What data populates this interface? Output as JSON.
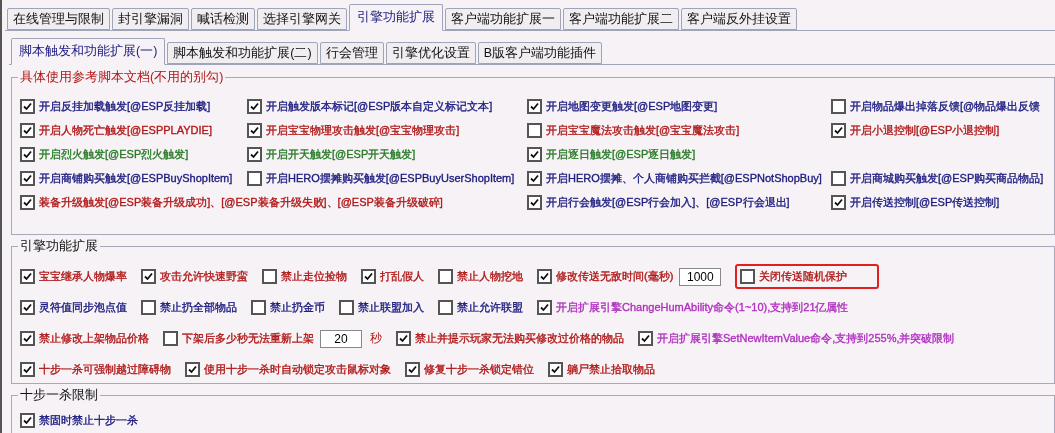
{
  "top_tabs": [
    {
      "label": "在线管理与限制",
      "selected": false
    },
    {
      "label": "封引擎漏洞",
      "selected": false
    },
    {
      "label": "喊话检测",
      "selected": false
    },
    {
      "label": "选择引擎网关",
      "selected": false
    },
    {
      "label": "引擎功能扩展",
      "selected": true
    },
    {
      "label": "客户端功能扩展一",
      "selected": false
    },
    {
      "label": "客户端功能扩展二",
      "selected": false
    },
    {
      "label": "客户端反外挂设置",
      "selected": false
    }
  ],
  "sub_tabs": [
    {
      "label": "脚本触发和功能扩展(一)",
      "selected": true
    },
    {
      "label": "脚本触发和功能扩展(二)",
      "selected": false
    },
    {
      "label": "行会管理",
      "selected": false
    },
    {
      "label": "引擎优化设置",
      "selected": false
    },
    {
      "label": "B版客户端功能插件",
      "selected": false
    }
  ],
  "script_group": {
    "title": "具体使用参考脚本文档(不用的别勾)",
    "rows": [
      [
        {
          "label": "开启反挂加载触发[@ESP反挂加载]",
          "checked": true,
          "color": "#1c1c80"
        },
        {
          "label": "开启触发版本标记[@ESP版本自定义标记文本]",
          "checked": true,
          "color": "#1c1c80"
        },
        {
          "label": "开启地图变更触发[@ESP地图变更]",
          "checked": true,
          "color": "#1c1c80"
        },
        {
          "label": "开启物品爆出掉落反馈[@物品爆出反馈",
          "checked": false,
          "color": "#1c1c80"
        }
      ],
      [
        {
          "label": "开启人物死亡触发[@ESPPLAYDIE]",
          "checked": true,
          "color": "#b01818"
        },
        {
          "label": "开启宝宝物理攻击触发[@宝宝物理攻击]",
          "checked": true,
          "color": "#b01818"
        },
        {
          "label": "开启宝宝魔法攻击触发[@宝宝魔法攻击]",
          "checked": false,
          "color": "#b01818"
        },
        {
          "label": "开启小退控制[@ESP小退控制]",
          "checked": true,
          "color": "#b01818"
        }
      ],
      [
        {
          "label": "开启烈火触发[@ESP烈火触发]",
          "checked": true,
          "color": "#267a26"
        },
        {
          "label": "开启开天触发[@ESP开天触发]",
          "checked": true,
          "color": "#267a26"
        },
        {
          "label": "开启逐日触发[@ESP逐日触发]",
          "checked": true,
          "color": "#267a26"
        }
      ],
      [
        {
          "label": "开启商铺购买触发[@ESPBuyShopItem]",
          "checked": true,
          "color": "#1c1c80"
        },
        {
          "label": "开启HERO摆摊购买触发[@ESPBuyUserShopItem]",
          "checked": false,
          "color": "#1c1c80"
        },
        {
          "label": "开启HERO摆摊、个人商铺购买拦截[@ESPNotShopBuy]",
          "checked": true,
          "color": "#1c1c80"
        },
        {
          "label": "开启商城购买触发[@ESP购买商品物品]",
          "checked": false,
          "color": "#1c1c80"
        }
      ],
      [
        {
          "label": "装备升级触发[@ESP装备升级成功]、[@ESP装备升级失败]、[@ESP装备升级破碎]",
          "checked": true,
          "color": "#b01818"
        },
        "",
        {
          "label": "开启行会触发[@ESP行会加入]、[@ESP行会退出]",
          "checked": true,
          "color": "#1c1c80"
        },
        {
          "label": "开启传送控制[@ESP传送控制]",
          "checked": true,
          "color": "#1c1c80"
        }
      ]
    ]
  },
  "engine_group": {
    "title": "引擎功能扩展",
    "lines": [
      {
        "items": [
          {
            "label": "宝宝继承人物爆率",
            "checked": true,
            "color": "#b01818"
          },
          {
            "label": "攻击允许快速野蛮",
            "checked": true,
            "color": "#b01818"
          },
          {
            "label": "禁止走位捡物",
            "checked": false,
            "color": "#b01818"
          },
          {
            "label": "打乱假人",
            "checked": true,
            "color": "#b01818"
          },
          {
            "label": "禁止人物挖地",
            "checked": false,
            "color": "#b01818"
          },
          {
            "label": "修改传送无敌时间(毫秒)",
            "checked": true,
            "color": "#b01818",
            "value": "1000"
          },
          {
            "label": "关闭传送随机保护",
            "checked": false,
            "color": "#b01818",
            "highlighted": true
          }
        ]
      },
      {
        "items": [
          {
            "label": "灵符值同步泡点值",
            "checked": true,
            "color": "#1c1c80"
          },
          {
            "label": "禁止扔全部物品",
            "checked": false,
            "color": "#1c1c80"
          },
          {
            "label": "禁止扔金币",
            "checked": false,
            "color": "#1c1c80"
          },
          {
            "label": "禁止联盟加入",
            "checked": false,
            "color": "#1c1c80"
          },
          {
            "label": "禁止允许联盟",
            "checked": false,
            "color": "#1c1c80"
          },
          {
            "label": "开启扩展引擎ChangeHumAbility命令(1~10),支持到21亿属性",
            "checked": true,
            "color": "#b030c0"
          }
        ]
      },
      {
        "items": [
          {
            "label": "禁止修改上架物品价格",
            "checked": true,
            "color": "#b01818"
          },
          {
            "label": "下架后多少秒无法重新上架",
            "checked": false,
            "color": "#b01818",
            "value": "20",
            "suffix": "秒"
          },
          {
            "label": "禁止并提示玩家无法购买修改过价格的物品",
            "checked": true,
            "color": "#b01818"
          },
          {
            "label": "开启扩展引擎SetNewItemValue命令,支持到255%,并突破限制",
            "checked": true,
            "color": "#b030c0"
          }
        ]
      },
      {
        "items": [
          {
            "label": "十步一杀可强制越过障碍物",
            "checked": true,
            "color": "#b01818"
          },
          {
            "label": "使用十步一杀时自动锁定攻击鼠标对象",
            "checked": true,
            "color": "#b01818"
          },
          {
            "label": "修复十步一杀锁定错位",
            "checked": true,
            "color": "#b01818"
          },
          {
            "label": "躺尸禁止拾取物品",
            "checked": true,
            "color": "#b01818"
          }
        ]
      }
    ]
  },
  "tenstep_group": {
    "title": "十步一杀限制",
    "lines": [
      {
        "items": [
          {
            "label": "禁固时禁止十步一杀",
            "checked": true,
            "color": "#1c1c80"
          }
        ]
      }
    ]
  }
}
